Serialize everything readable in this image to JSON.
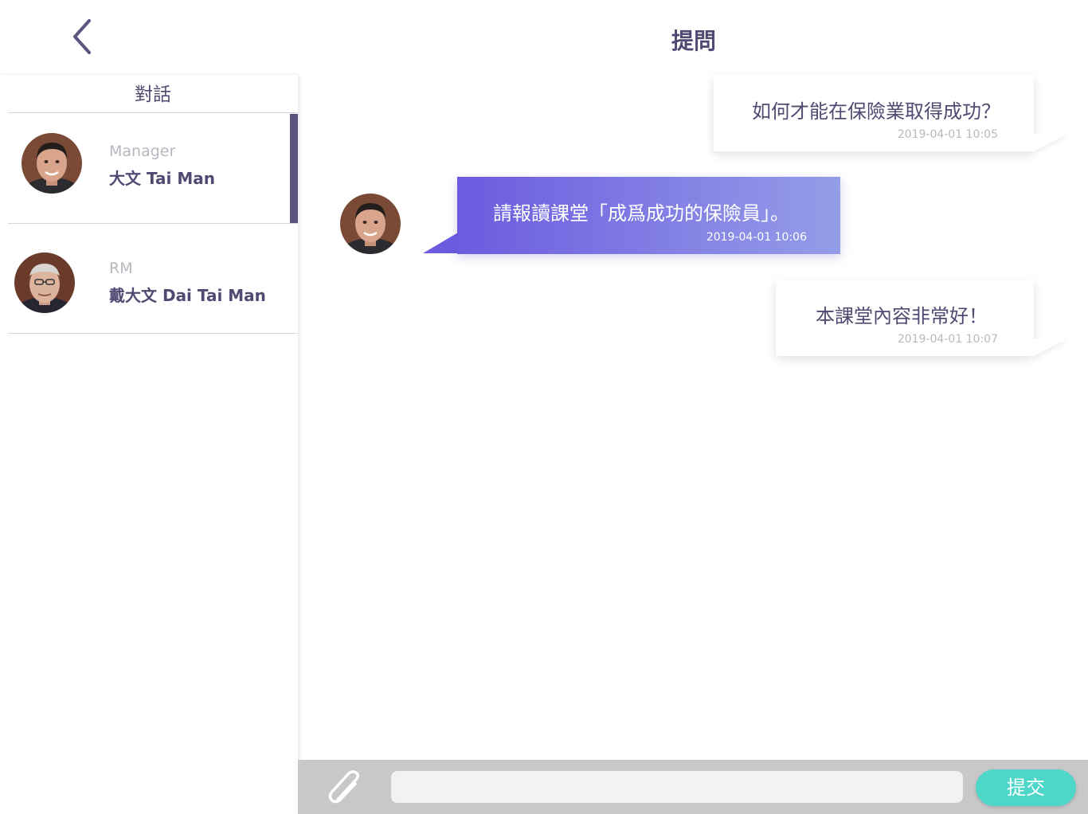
{
  "header": {
    "title": "提問"
  },
  "sidebar": {
    "title": "對話",
    "conversations": [
      {
        "role": "Manager",
        "name": "大文 Tai Man",
        "active": true
      },
      {
        "role": "RM",
        "name": "戴大文 Dai Tai Man",
        "active": false
      }
    ]
  },
  "messages": [
    {
      "direction": "outgoing",
      "text": "如何才能在保險業取得成功？",
      "time": "2019-04-01 10:05"
    },
    {
      "direction": "incoming",
      "text": "請報讀課堂「成爲成功的保險員」。",
      "time": "2019-04-01 10:06"
    },
    {
      "direction": "outgoing",
      "text": "本課堂內容非常好！",
      "time": "2019-04-01 10:07"
    }
  ],
  "composer": {
    "placeholder": "",
    "submit_label": "提交"
  },
  "icons": {
    "back": "chevron-left-icon",
    "attach": "paperclip-icon"
  },
  "colors": {
    "accent": "#5a5480",
    "gradient_start": "#6c5bdf",
    "gradient_end": "#949de8",
    "submit": "#4ed6c9"
  }
}
